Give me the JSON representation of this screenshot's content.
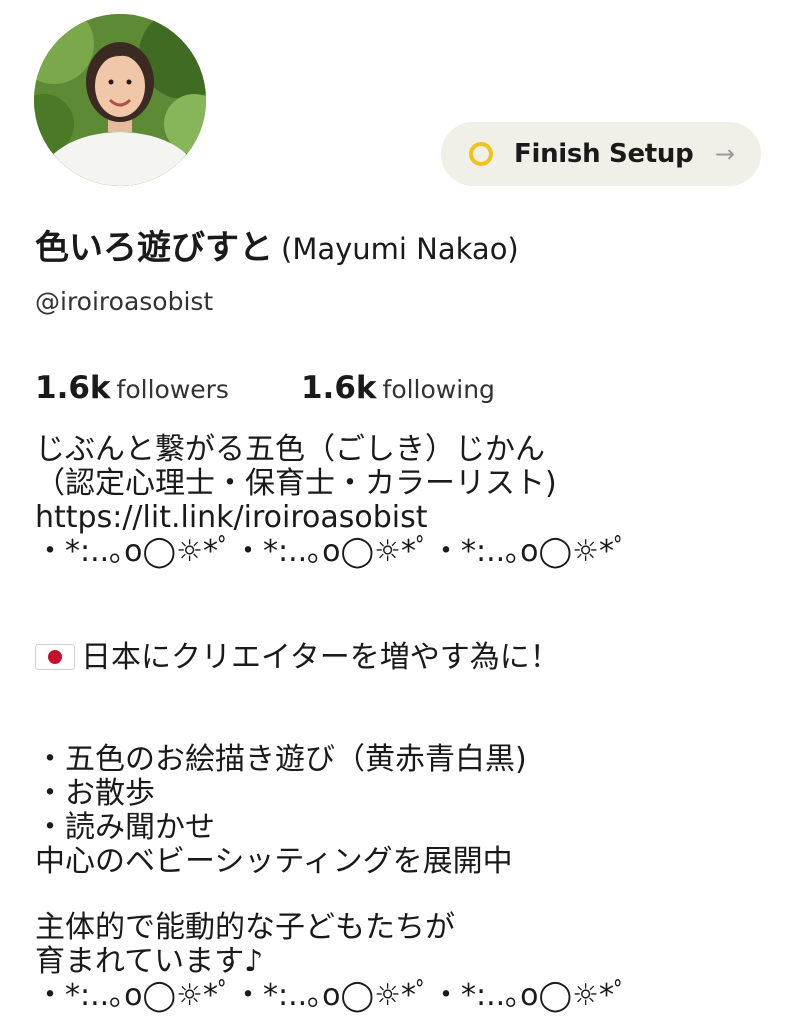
{
  "profile": {
    "display_name": "色いろ遊びすと",
    "real_name": "(Mayumi Nakao)",
    "handle": "@iroiroasobist",
    "avatar_icon": "profile-photo"
  },
  "setup": {
    "label": "Finish Setup",
    "ring_color": "#f2c21b",
    "arrow": "→"
  },
  "stats": {
    "followers_count": "1.6k",
    "followers_label": "followers",
    "following_count": "1.6k",
    "following_label": "following"
  },
  "bio": {
    "line1": "じぶんと繋がる五色（ごしき）じかん",
    "line2": "（認定心理士・保育士・カラーリスト)",
    "link": "https://lit.link/iroiroasobist",
    "deco1": "・*:..｡o◯☼*ﾟ・*:..｡o◯☼*ﾟ・*:..｡o◯☼*ﾟ",
    "line_flag": "日本にクリエイターを増やす為に！",
    "item1": "・五色のお絵描き遊び（黄赤青白黒)",
    "item2": "・お散歩",
    "item3": "・読み聞かせ",
    "line_center": "中心のベビーシッティングを展開中",
    "line_child1": "主体的で能動的な子どもたちが",
    "line_child2": "育まれています♪",
    "deco2": "・*:..｡o◯☼*ﾟ・*:..｡o◯☼*ﾟ・*:..｡o◯☼*ﾟ"
  }
}
